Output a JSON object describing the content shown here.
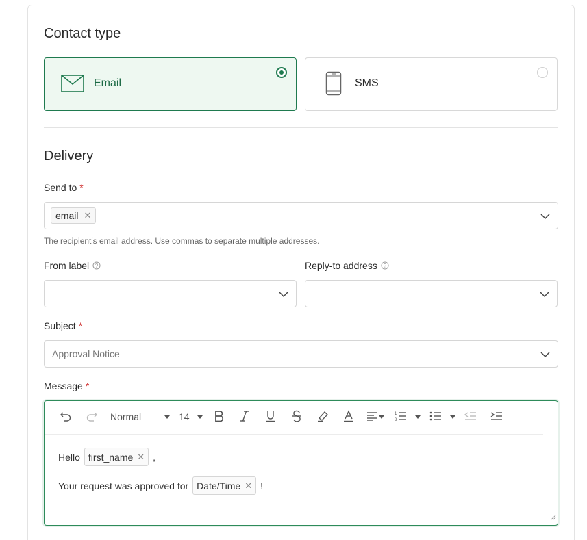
{
  "contact_type": {
    "title": "Contact type",
    "options": [
      {
        "label": "Email",
        "selected": true
      },
      {
        "label": "SMS",
        "selected": false
      }
    ]
  },
  "delivery": {
    "title": "Delivery",
    "send_to": {
      "label": "Send to",
      "required_mark": "*",
      "tags": [
        "email"
      ],
      "hint": "The recipient's email address. Use commas to separate multiple addresses."
    },
    "from_label": {
      "label": "From label",
      "value": ""
    },
    "reply_to": {
      "label": "Reply-to address",
      "value": ""
    },
    "subject": {
      "label": "Subject",
      "required_mark": "*",
      "value": "Approval Notice"
    },
    "message": {
      "label": "Message",
      "required_mark": "*",
      "toolbar": {
        "style": "Normal",
        "size": "14"
      },
      "line1": {
        "prefix": "Hello",
        "variable": "first_name",
        "suffix": ","
      },
      "line2": {
        "prefix": "Your request was approved for",
        "variable": "Date/Time",
        "suffix": "!"
      }
    }
  },
  "colors": {
    "accent": "#1f7a4f",
    "required": "#d23b3b",
    "selected_bg": "#eef8f1"
  }
}
